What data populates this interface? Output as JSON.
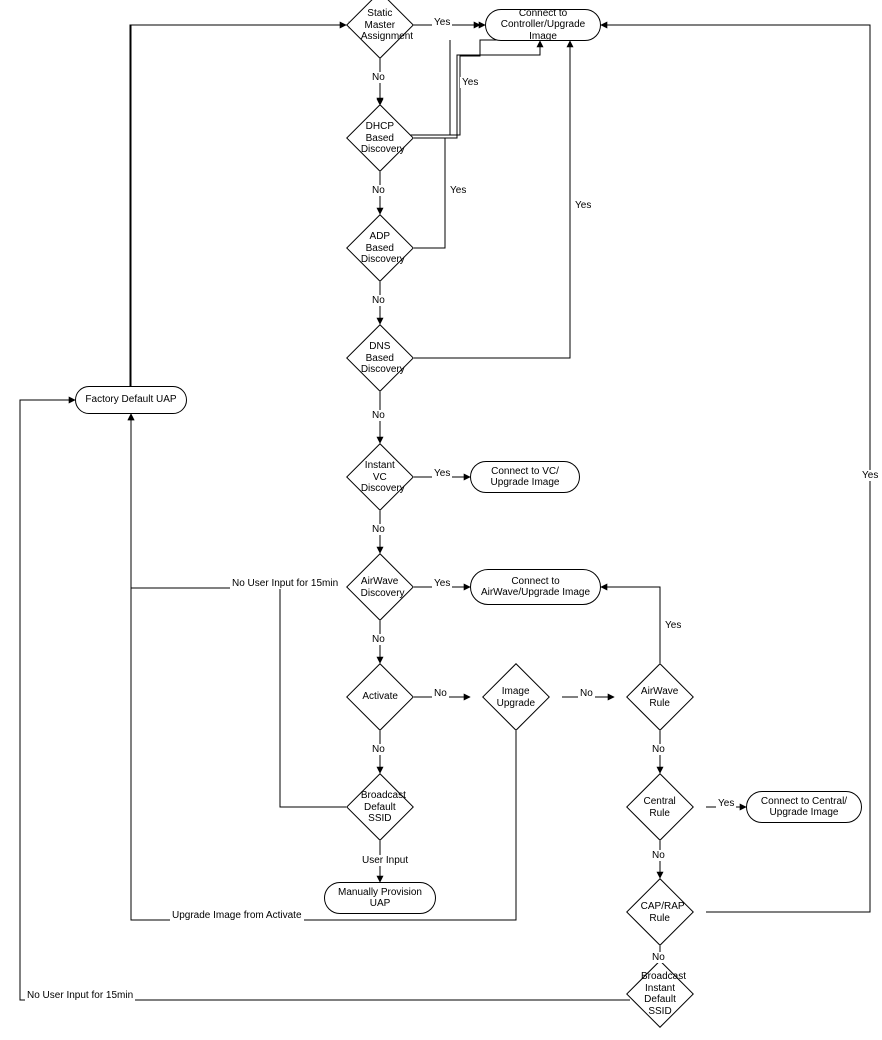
{
  "nodes": {
    "static_master": "Static Master Assignment",
    "connect_controller": "Connect to Controller/Upgrade Image",
    "dhcp": "DHCP Based Discovery",
    "adp": "ADP Based Discovery",
    "dns": "DNS Based Discovery",
    "factory_default": "Factory Default UAP",
    "instant_vc": "Instant VC Discovery",
    "connect_vc": "Connect to VC/ Upgrade Image",
    "airwave": "AirWave Discovery",
    "connect_airwave": "Connect to AirWave/Upgrade Image",
    "activate": "Activate",
    "image_upgrade": "Image Upgrade",
    "airwave_rule": "AirWave Rule",
    "broadcast_default": "Broadcast Default SSID",
    "central_rule": "Central Rule",
    "connect_central": "Connect to Central/ Upgrade Image",
    "manual_provision": "Manually Provision UAP",
    "cap_rap": "CAP/RAP Rule",
    "broadcast_instant": "Broadcast Instant Default SSID"
  },
  "labels": {
    "yes": "Yes",
    "no": "No",
    "user_input": "User Input",
    "no_user_15": "No User Input for 15min",
    "upgrade_from_activate": "Upgrade Image from Activate"
  }
}
